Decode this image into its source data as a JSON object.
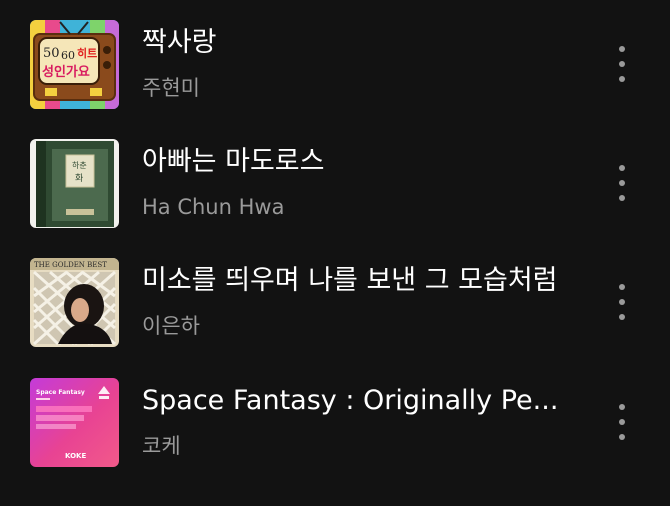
{
  "tracks": [
    {
      "title": "짝사랑",
      "artist": "주현미",
      "art_text": [
        "50",
        "60",
        "히트",
        "성인가요"
      ],
      "more_icon": "more-vertical-icon"
    },
    {
      "title": "아빠는 마도로스",
      "artist": "Ha Chun Hwa",
      "art_text": [
        "하춘",
        "화"
      ],
      "more_icon": "more-vertical-icon"
    },
    {
      "title": "미소를 띄우며 나를 보낸 그 모습처럼",
      "artist": "이은하",
      "art_text": [
        "THE GOLDEN BEST"
      ],
      "more_icon": "more-vertical-icon"
    },
    {
      "title": "Space Fantasy : Originally Pe...",
      "artist": "코케",
      "art_text": [
        "Space Fantasy",
        "KOKE"
      ],
      "more_icon": "more-vertical-icon"
    }
  ],
  "colors": {
    "background": "#121212",
    "title": "#ffffff",
    "subtitle": "#9a9a9a"
  }
}
